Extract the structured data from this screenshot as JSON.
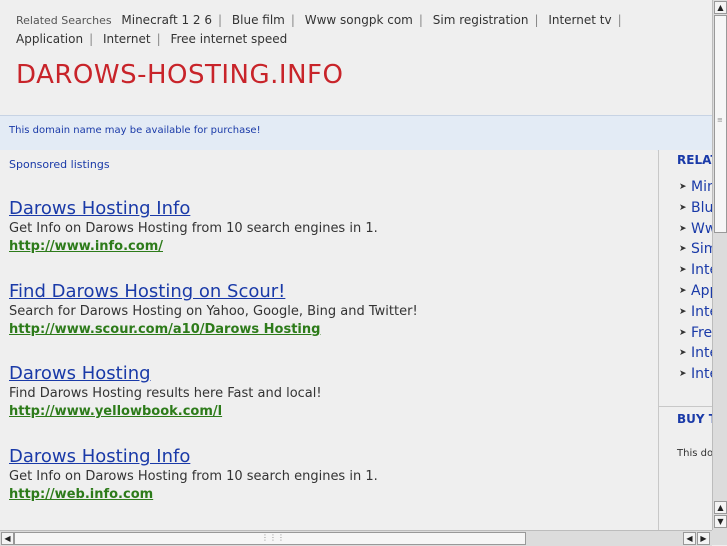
{
  "topbar": {
    "related_label": "Related Searches",
    "related_links": [
      "Minecraft 1 2 6",
      "Blue film",
      "Www songpk com",
      "Sim registration",
      "Internet tv",
      "Application",
      "Internet",
      "Free internet speed"
    ]
  },
  "site_title": "DAROWS-HOSTING.INFO",
  "notice": "This domain name may be available for purchase!",
  "main": {
    "sponsored_label": "Sponsored listings",
    "listings": [
      {
        "title": "Darows Hosting Info",
        "desc": "Get Info on Darows Hosting from 10 search engines in 1.",
        "url": "http://www.info.com/"
      },
      {
        "title": "Find Darows Hosting on Scour!",
        "desc": "Search for Darows Hosting on Yahoo, Google, Bing and Twitter!",
        "url": "http://www.scour.com/a10/Darows Hosting"
      },
      {
        "title": "Darows Hosting",
        "desc": "Find Darows Hosting results here Fast and local!",
        "url": "http://www.yellowbook.com/l"
      },
      {
        "title": "Darows Hosting Info",
        "desc": "Get Info on Darows Hosting from 10 search engines in 1.",
        "url": "http://web.info.com"
      }
    ]
  },
  "sidebar": {
    "related_heading": "RELAT",
    "items": [
      "Min",
      "Blu",
      "Ww",
      "Sim",
      "Inte",
      "App",
      "Inte",
      "Fre",
      "Inte",
      "Inte"
    ],
    "buy_heading": "BUY T",
    "small_text": "This do"
  },
  "icons": {
    "scroll_up": "scroll-up-arrow-icon",
    "scroll_down": "scroll-down-arrow-icon",
    "scroll_left": "scroll-left-arrow-icon",
    "scroll_right": "scroll-right-arrow-icon",
    "bullet": "bullet-arrow-icon"
  },
  "colors": {
    "title_red": "#c8242a",
    "link_blue": "#1a3aa8",
    "url_green": "#2d7b1a",
    "notice_bg": "#e3ebf5"
  }
}
